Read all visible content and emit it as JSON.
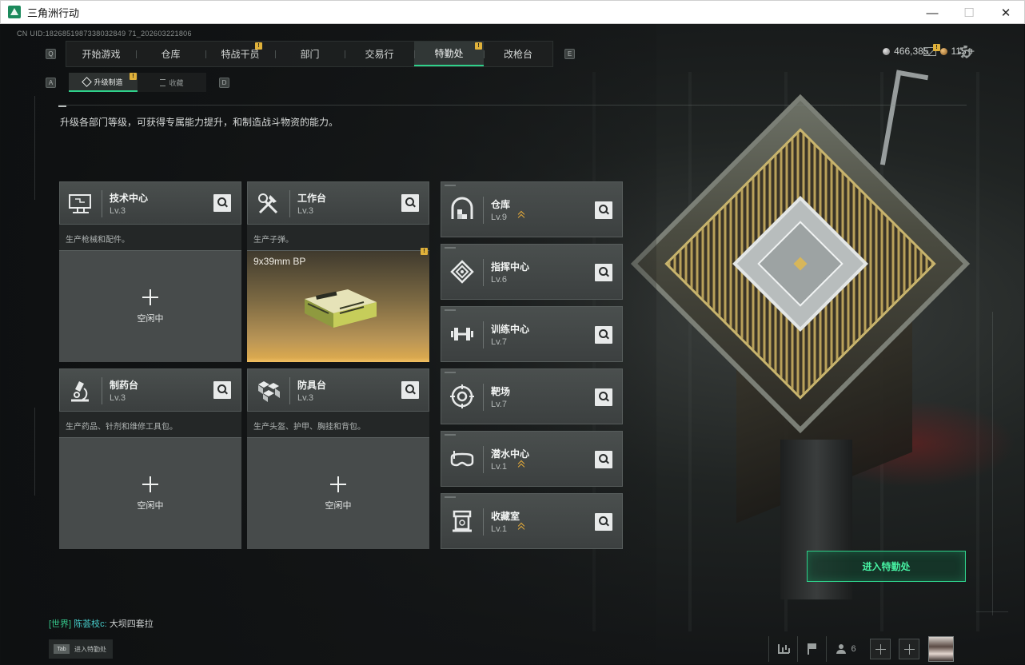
{
  "window": {
    "title": "三角洲行动",
    "minimize": "—",
    "maximize": "☐",
    "close": "✕"
  },
  "uid": "CN UID:1826851987338032849 71_202603221806",
  "nav": {
    "left_key": "Q",
    "right_key": "E",
    "tabs": [
      {
        "label": "开始游戏",
        "badge": ""
      },
      {
        "label": "仓库",
        "badge": ""
      },
      {
        "label": "特战干员",
        "badge": "!"
      },
      {
        "label": "部门",
        "badge": ""
      },
      {
        "label": "交易行",
        "badge": ""
      },
      {
        "label": "特勤处",
        "badge": "!",
        "active": true
      },
      {
        "label": "改枪台",
        "badge": ""
      }
    ]
  },
  "currency": {
    "silver": "466,385",
    "gold": "115 +"
  },
  "mail_badge": "!",
  "subnav": {
    "left_key": "A",
    "right_key": "D",
    "tabs": [
      {
        "label": "升级制造",
        "badge": "!",
        "active": true
      },
      {
        "label": "收藏",
        "badge": ""
      }
    ]
  },
  "description": "升级各部门等级，可获得专属能力提升，和制造战斗物资的能力。",
  "production": [
    {
      "name": "技术中心",
      "level": "Lv.3",
      "desc": "生产枪械和配件。",
      "status": "空闲中",
      "icon": "computer-icon"
    },
    {
      "name": "工作台",
      "level": "Lv.3",
      "desc": "生产子弹。",
      "item": "9x39mm BP",
      "badge": "!",
      "icon": "tools-icon"
    },
    {
      "name": "制药台",
      "level": "Lv.3",
      "desc": "生产药品、针剂和维修工具包。",
      "status": "空闲中",
      "icon": "microscope-icon"
    },
    {
      "name": "防具台",
      "level": "Lv.3",
      "desc": "生产头盔、护甲、胸挂和背包。",
      "status": "空闲中",
      "icon": "boxes-icon"
    }
  ],
  "departments": [
    {
      "name": "仓库",
      "level": "Lv.9",
      "upgradable": true,
      "icon": "warehouse-icon"
    },
    {
      "name": "指挥中心",
      "level": "Lv.6",
      "upgradable": false,
      "icon": "command-chip-icon"
    },
    {
      "name": "训练中心",
      "level": "Lv.7",
      "upgradable": false,
      "icon": "dumbbell-icon"
    },
    {
      "name": "靶场",
      "level": "Lv.7",
      "upgradable": false,
      "icon": "target-icon"
    },
    {
      "name": "潜水中心",
      "level": "Lv.1",
      "upgradable": true,
      "icon": "diving-mask-icon"
    },
    {
      "name": "收藏室",
      "level": "Lv.1",
      "upgradable": true,
      "icon": "collection-case-icon"
    }
  ],
  "enter_button": "进入特勤处",
  "chat": {
    "channel": "[世界]",
    "sender": "陈荟枝c:",
    "message": "大坝四套拉"
  },
  "tab_hint": {
    "key": "Tab",
    "label": "进入特勤处"
  },
  "bottom": {
    "friends_count": "6"
  },
  "colors": {
    "accent": "#2fd08a",
    "badge": "#e0b13a",
    "upgrade_arrow": "#e2a93a"
  }
}
